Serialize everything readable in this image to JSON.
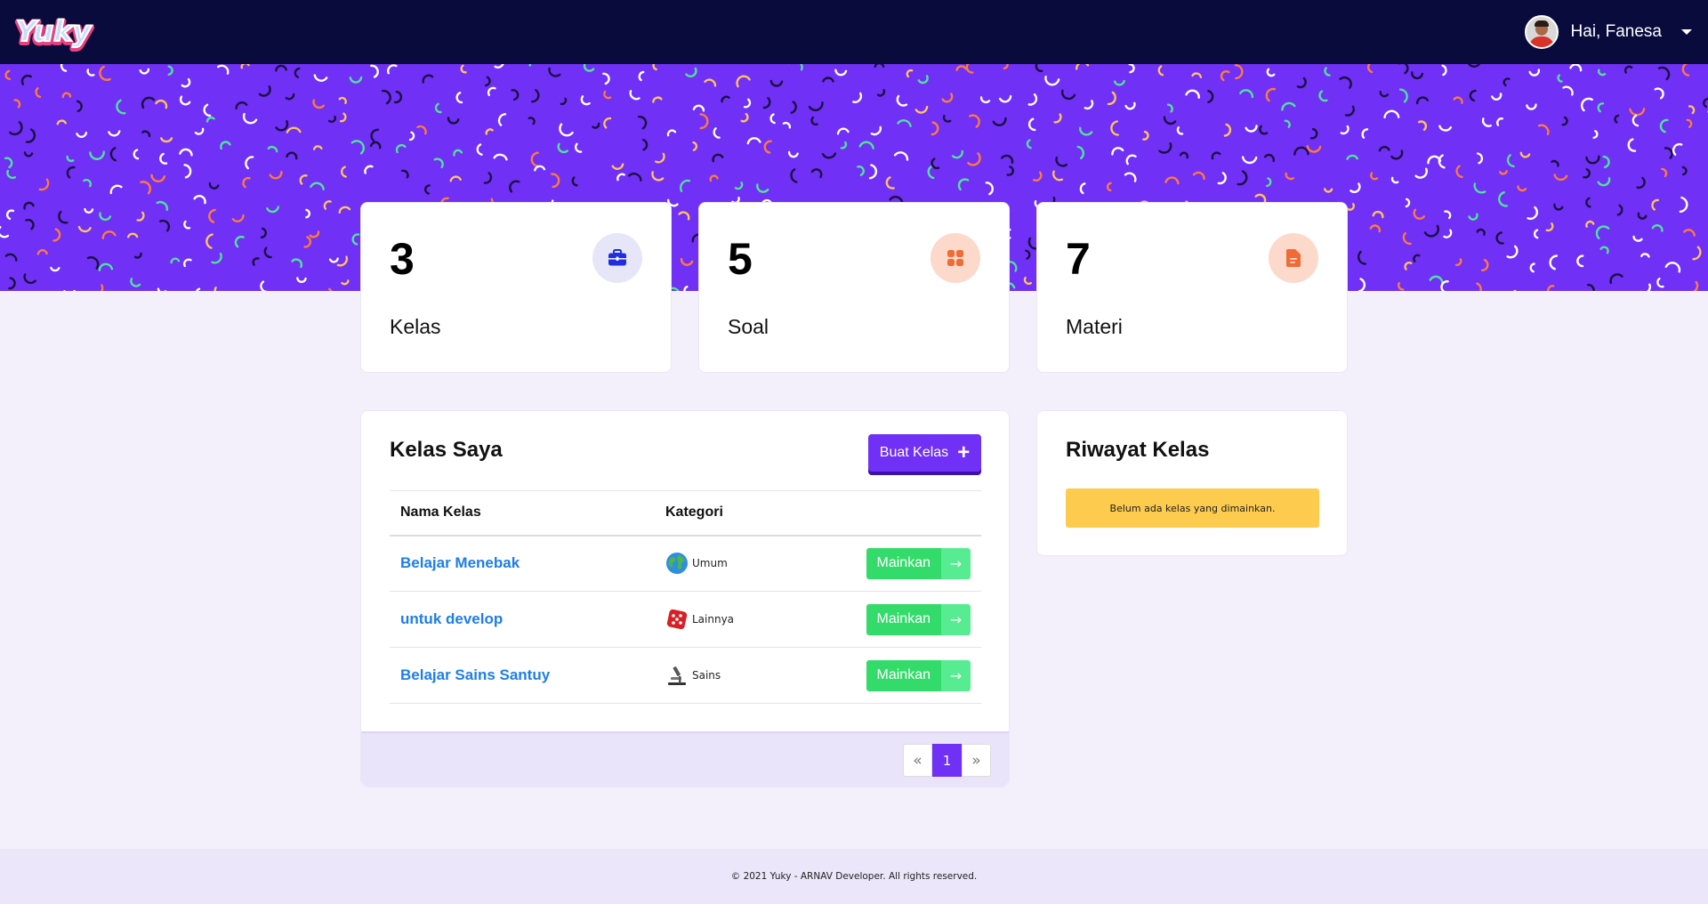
{
  "app": {
    "brand": "Yuky"
  },
  "header": {
    "greeting": "Hai, Fanesa"
  },
  "stats": [
    {
      "value": "3",
      "label": "Kelas",
      "icon": "briefcase-icon",
      "icon_bg": "#e6e6f8",
      "icon_color": "#1e2ee0"
    },
    {
      "value": "5",
      "label": "Soal",
      "icon": "grid-icon",
      "icon_bg": "#fcd9cb",
      "icon_color": "#f06b35"
    },
    {
      "value": "7",
      "label": "Materi",
      "icon": "document-icon",
      "icon_bg": "#fcd9cb",
      "icon_color": "#f06b35"
    }
  ],
  "my_classes": {
    "title": "Kelas Saya",
    "create_button": "Buat Kelas",
    "columns": [
      "Nama Kelas",
      "Kategori"
    ],
    "rows": [
      {
        "name": "Belajar Menebak",
        "category": "Umum",
        "category_icon": "globe-icon",
        "action": "Mainkan"
      },
      {
        "name": "untuk develop",
        "category": "Lainnya",
        "category_icon": "dice-icon",
        "action": "Mainkan"
      },
      {
        "name": "Belajar Sains Santuy",
        "category": "Sains",
        "category_icon": "microscope-icon",
        "action": "Mainkan"
      }
    ],
    "pagination": {
      "prev": "«",
      "current": "1",
      "next": "»"
    }
  },
  "history": {
    "title": "Riwayat Kelas",
    "empty_message": "Belum ada kelas yang dimainkan."
  },
  "footer": {
    "text": "© 2021 Yuky - ARNAV Developer. All rights reserved."
  },
  "colors": {
    "navbar": "#090b3d",
    "primary": "#7030f5",
    "play": "#33dc6a",
    "link": "#1e7ee8",
    "warning": "#fdcb4d",
    "page_bg": "#f3f0fc"
  }
}
